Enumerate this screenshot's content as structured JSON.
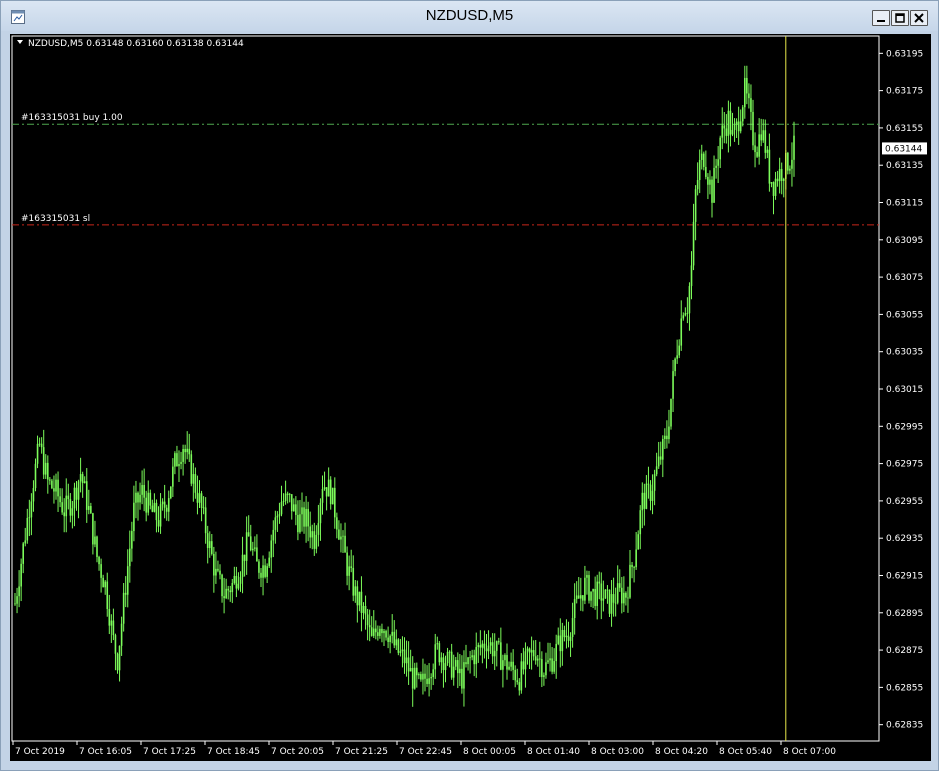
{
  "window": {
    "title": "NZDUSD,M5"
  },
  "colors": {
    "background": "#000000",
    "candle": "#7CFC5A",
    "buy_line": "#4FA84F",
    "sl_line": "#C8261A",
    "period_separator": "#E8E84A",
    "axis": "#FFFFFF",
    "price_label_bg": "#FFFFFF"
  },
  "chart_data": {
    "type": "candlestick",
    "symbol_line": "NZDUSD,M5  0.63148 0.63160 0.63138 0.63144",
    "current_price": "0.63144",
    "ylim": [
      0.6283,
      0.632
    ],
    "y_ticks": [
      "0.63195",
      "0.63175",
      "0.63155",
      "0.63135",
      "0.63115",
      "0.63095",
      "0.63075",
      "0.63055",
      "0.63035",
      "0.63015",
      "0.62995",
      "0.62975",
      "0.62955",
      "0.62935",
      "0.62915",
      "0.62895",
      "0.62875",
      "0.62855",
      "0.62835"
    ],
    "x_ticks": [
      "7 Oct 2019",
      "7 Oct 16:05",
      "7 Oct 17:25",
      "7 Oct 18:45",
      "7 Oct 20:05",
      "7 Oct 21:25",
      "7 Oct 22:45",
      "8 Oct 00:05",
      "8 Oct 01:40",
      "8 Oct 03:00",
      "8 Oct 04:20",
      "8 Oct 05:40",
      "8 Oct 07:00"
    ],
    "order_lines": [
      {
        "label": "#163315031 buy 1.00",
        "price": 0.63157
      },
      {
        "label": "#163315031 sl",
        "price": 0.63103
      }
    ],
    "close_path": [
      [
        0,
        0.629
      ],
      [
        4,
        0.6293
      ],
      [
        8,
        0.6296
      ],
      [
        12,
        0.62985
      ],
      [
        16,
        0.62965
      ],
      [
        20,
        0.6296
      ],
      [
        24,
        0.6295
      ],
      [
        28,
        0.62955
      ],
      [
        32,
        0.6297
      ],
      [
        36,
        0.6295
      ],
      [
        40,
        0.62925
      ],
      [
        44,
        0.6291
      ],
      [
        48,
        0.6288
      ],
      [
        50,
        0.6287
      ],
      [
        52,
        0.6289
      ],
      [
        55,
        0.6292
      ],
      [
        58,
        0.6295
      ],
      [
        62,
        0.6296
      ],
      [
        66,
        0.6295
      ],
      [
        70,
        0.62945
      ],
      [
        74,
        0.62955
      ],
      [
        78,
        0.62975
      ],
      [
        82,
        0.62985
      ],
      [
        86,
        0.6297
      ],
      [
        90,
        0.62955
      ],
      [
        94,
        0.62935
      ],
      [
        98,
        0.62915
      ],
      [
        102,
        0.62905
      ],
      [
        106,
        0.6291
      ],
      [
        110,
        0.6292
      ],
      [
        114,
        0.62935
      ],
      [
        118,
        0.6292
      ],
      [
        122,
        0.6292
      ],
      [
        126,
        0.6294
      ],
      [
        130,
        0.62955
      ],
      [
        134,
        0.62955
      ],
      [
        138,
        0.62945
      ],
      [
        142,
        0.62945
      ],
      [
        146,
        0.62935
      ],
      [
        150,
        0.62965
      ],
      [
        154,
        0.6296
      ],
      [
        158,
        0.6294
      ],
      [
        162,
        0.6292
      ],
      [
        166,
        0.62905
      ],
      [
        170,
        0.62895
      ],
      [
        174,
        0.6288
      ],
      [
        178,
        0.6289
      ],
      [
        182,
        0.62885
      ],
      [
        186,
        0.62875
      ],
      [
        190,
        0.6287
      ],
      [
        194,
        0.6286
      ],
      [
        198,
        0.62855
      ],
      [
        202,
        0.62865
      ],
      [
        206,
        0.62875
      ],
      [
        210,
        0.6287
      ],
      [
        214,
        0.62865
      ],
      [
        218,
        0.6286
      ],
      [
        222,
        0.6287
      ],
      [
        226,
        0.62875
      ],
      [
        230,
        0.6288
      ],
      [
        234,
        0.62875
      ],
      [
        238,
        0.6287
      ],
      [
        242,
        0.62865
      ],
      [
        246,
        0.6286
      ],
      [
        250,
        0.6287
      ],
      [
        254,
        0.62875
      ],
      [
        258,
        0.62865
      ],
      [
        262,
        0.6287
      ],
      [
        266,
        0.6288
      ],
      [
        270,
        0.62885
      ],
      [
        274,
        0.629
      ],
      [
        278,
        0.6291
      ],
      [
        282,
        0.62905
      ],
      [
        286,
        0.62905
      ],
      [
        290,
        0.629
      ],
      [
        294,
        0.62905
      ],
      [
        298,
        0.62905
      ],
      [
        302,
        0.62925
      ],
      [
        306,
        0.62955
      ],
      [
        310,
        0.6296
      ],
      [
        314,
        0.62975
      ],
      [
        318,
        0.6299
      ],
      [
        322,
        0.6303
      ],
      [
        326,
        0.6306
      ],
      [
        328,
        0.6306
      ],
      [
        330,
        0.6308
      ],
      [
        332,
        0.6312
      ],
      [
        334,
        0.63135
      ],
      [
        336,
        0.6314
      ],
      [
        338,
        0.6313
      ],
      [
        340,
        0.6312
      ],
      [
        342,
        0.63135
      ],
      [
        344,
        0.6315
      ],
      [
        346,
        0.63155
      ],
      [
        348,
        0.6316
      ],
      [
        350,
        0.6315
      ],
      [
        352,
        0.63155
      ],
      [
        354,
        0.63165
      ],
      [
        356,
        0.63175
      ],
      [
        358,
        0.63165
      ],
      [
        360,
        0.6315
      ],
      [
        362,
        0.63145
      ],
      [
        364,
        0.63155
      ],
      [
        366,
        0.63145
      ],
      [
        368,
        0.6313
      ],
      [
        370,
        0.63125
      ],
      [
        372,
        0.6313
      ],
      [
        374,
        0.63132
      ],
      [
        376,
        0.63135
      ],
      [
        378,
        0.63138
      ],
      [
        380,
        0.63144
      ]
    ],
    "separator_bar": 376
  }
}
